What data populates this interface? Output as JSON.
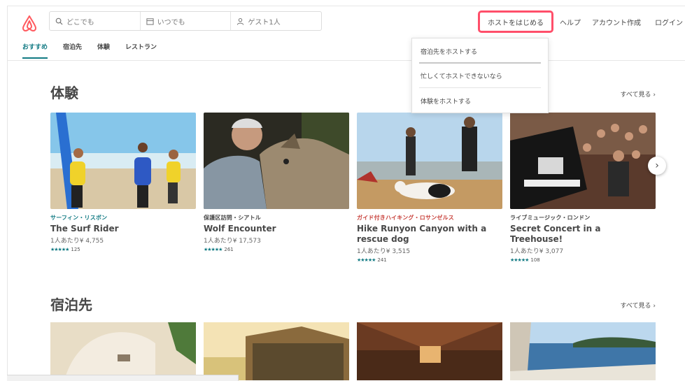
{
  "search": {
    "where": "どこでも",
    "when": "いつでも",
    "guests": "ゲスト1人"
  },
  "header": {
    "host_button": "ホストをはじめる",
    "help": "ヘルプ",
    "signup": "アカウント作成",
    "login": "ログイン"
  },
  "tabs": [
    "おすすめ",
    "宿泊先",
    "体験",
    "レストラン"
  ],
  "host_menu": {
    "items": [
      "宿泊先をホストする",
      "忙しくてホストできないなら",
      "体験をホストする"
    ]
  },
  "experiences": {
    "title": "体験",
    "see_all": "すべて見る ›",
    "cards": [
      {
        "kicker": "サーフィン・リスボン",
        "kicker_color": "#117a83",
        "title": "The Surf Rider",
        "price": "1人あたり¥ 4,755",
        "reviews": "125"
      },
      {
        "kicker": "保護区訪問・シアトル",
        "kicker_color": "#484848",
        "title": "Wolf Encounter",
        "price": "1人あたり¥ 17,573",
        "reviews": "261"
      },
      {
        "kicker": "ガイド付きハイキング・ロサンゼルス",
        "kicker_color": "#c8413b",
        "title": "Hike Runyon Canyon with a rescue dog",
        "price": "1人あたり¥ 3,515",
        "reviews": "241"
      },
      {
        "kicker": "ライブミュージック・ロンドン",
        "kicker_color": "#484848",
        "title": "Secret Concert in a Treehouse!",
        "price": "1人あたり¥ 3,077",
        "reviews": "108"
      }
    ]
  },
  "stays": {
    "title": "宿泊先",
    "see_all": "すべて見る ›"
  },
  "icons": {
    "logo": "airbnb-logo",
    "search": "search-icon",
    "calendar": "calendar-icon",
    "guests": "person-icon",
    "next": "chevron-right-icon"
  },
  "colors": {
    "brand": "#ff5a5f",
    "accent": "#117a83",
    "highlight": "#ff4f6a"
  }
}
